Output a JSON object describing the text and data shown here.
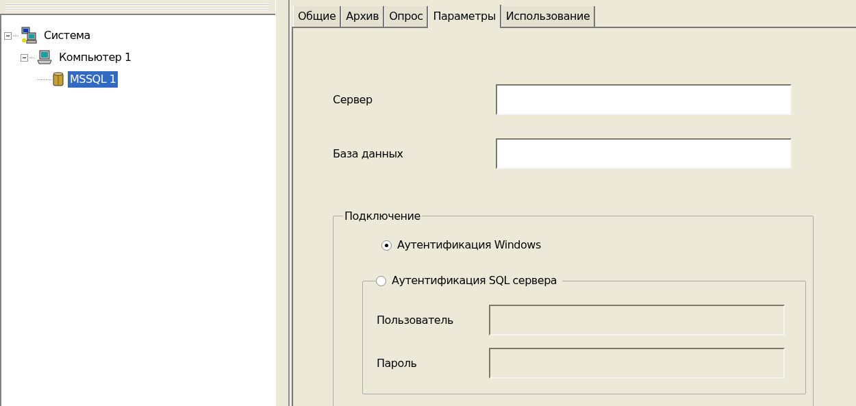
{
  "tree": [
    {
      "label": "Система",
      "kind": "network",
      "expanded": true,
      "selected": false,
      "children": [
        {
          "label": "Компьютер 1",
          "kind": "computer",
          "expanded": true,
          "selected": false,
          "children": [
            {
              "label": "MSSQL 1",
              "kind": "database",
              "selected": true
            }
          ]
        }
      ]
    }
  ],
  "tabs": [
    {
      "label": "Общие",
      "selected": false
    },
    {
      "label": "Архив",
      "selected": false
    },
    {
      "label": "Опрос",
      "selected": false
    },
    {
      "label": "Параметры",
      "selected": true
    },
    {
      "label": "Использование",
      "selected": false
    }
  ],
  "fields": [
    {
      "label": "Сервер",
      "disabled": false
    },
    {
      "label": "База данных",
      "disabled": false
    }
  ],
  "connection": {
    "title": "Подключение",
    "options": [
      {
        "label": "Аутентификация Windows",
        "selected": true
      },
      {
        "label": "Аутентификация SQL сервера",
        "selected": false
      }
    ],
    "credentials": [
      {
        "label": "Пользователь",
        "disabled": true
      },
      {
        "label": "Пароль",
        "disabled": true
      }
    ]
  }
}
